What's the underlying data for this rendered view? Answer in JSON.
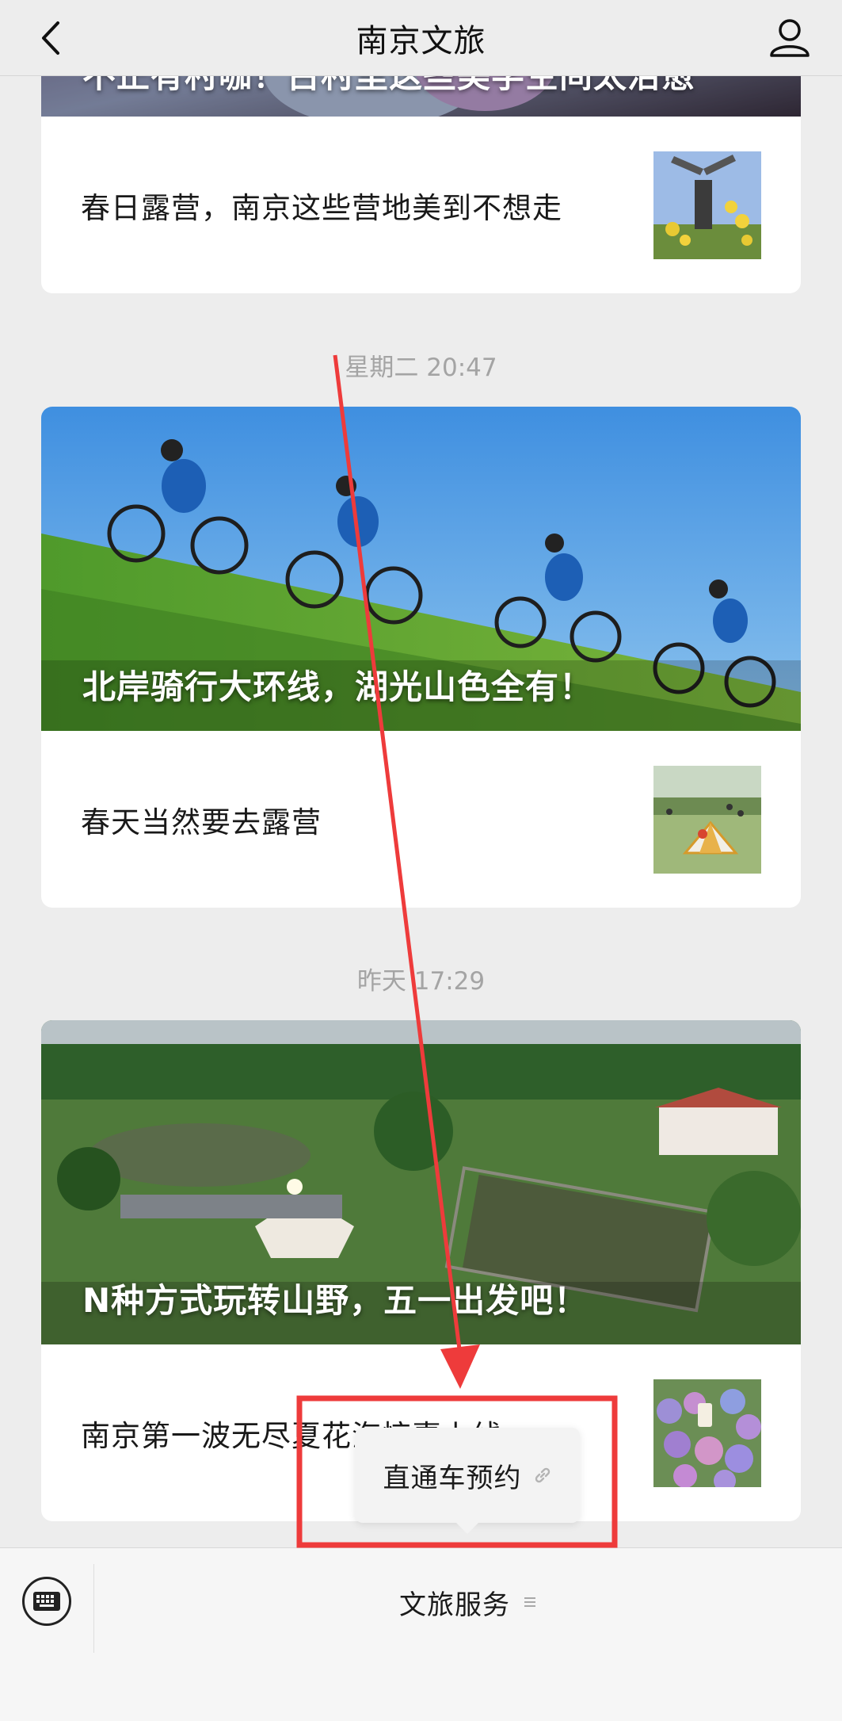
{
  "navbar": {
    "title": "南京文旅",
    "back_icon": "chevron-left-icon",
    "profile_icon": "person-icon"
  },
  "articles": [
    {
      "cover_title": "不止有村咖！古村里这些美学空间太治愈",
      "sub_title": "春日露营，南京这些营地美到不想走"
    },
    {
      "timestamp": "星期二 20:47",
      "cover_title": "北岸骑行大环线，湖光山色全有！",
      "sub_title": "春天当然要去露营"
    },
    {
      "timestamp": "昨天 17:29",
      "cover_title": "N种方式玩转山野，五一出发吧！",
      "sub_title": "南京第一波无尽夏花海惊喜上线"
    }
  ],
  "popup_menu": {
    "item_label": "直通车预约",
    "item_icon": "link-icon"
  },
  "bottom_bar": {
    "keyboard_icon": "keyboard-icon",
    "menu_label": "文旅服务",
    "menu_icon": "menu-lines-icon"
  },
  "annotation": {
    "arrow_color": "#ee3b3b",
    "highlight_color": "#ee3b3b"
  }
}
